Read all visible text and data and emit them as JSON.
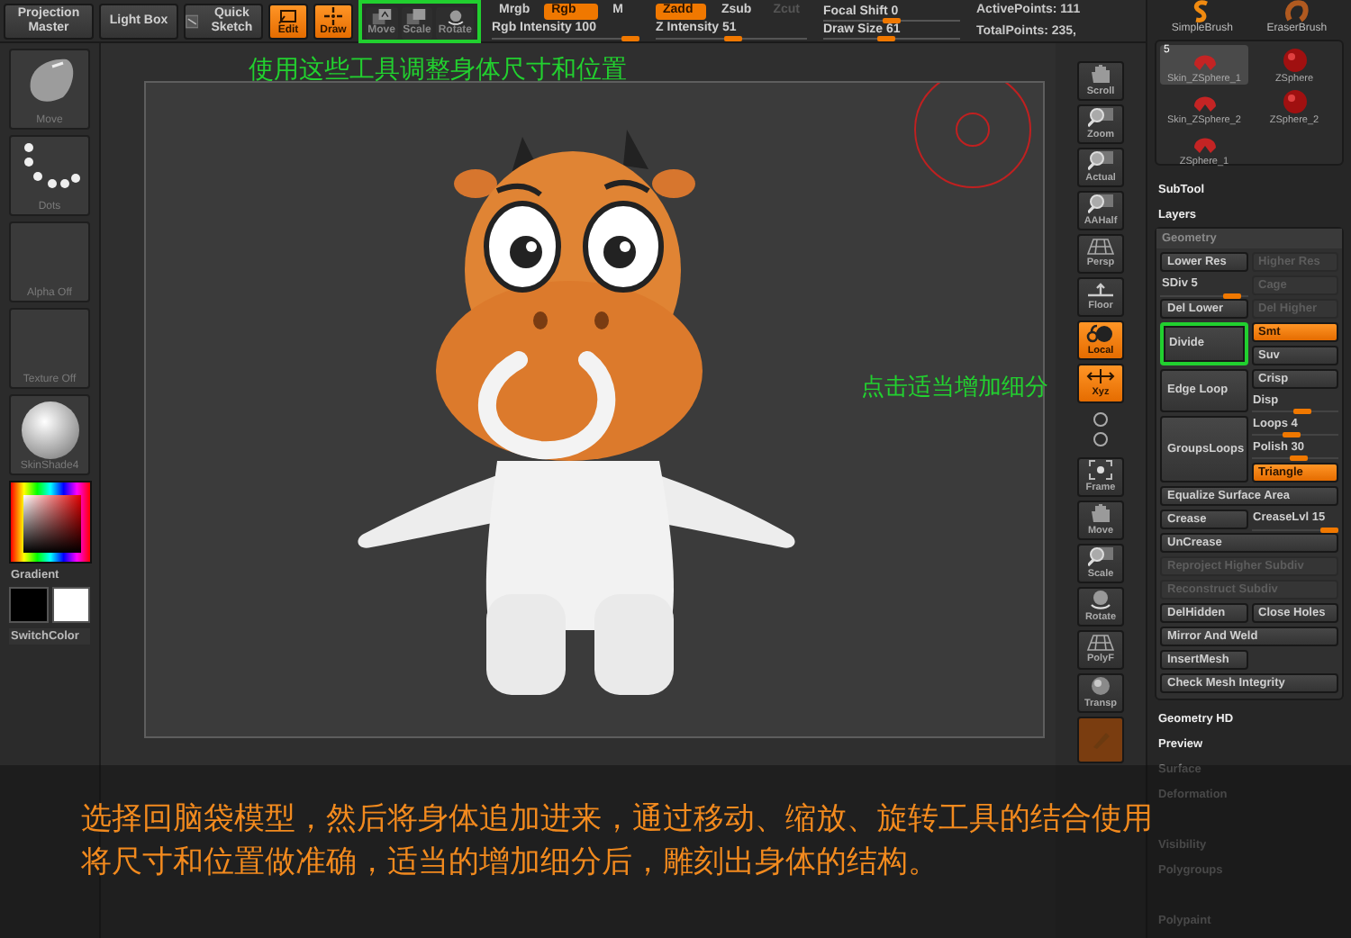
{
  "top_bar": {
    "buttons": [
      {
        "label": "Projection Master",
        "kind": "text",
        "on": false
      },
      {
        "label": "Light Box",
        "kind": "text",
        "on": false
      },
      {
        "label": "Quick Sketch",
        "kind": "sketch",
        "on": false
      },
      {
        "label": "Edit",
        "kind": "edit",
        "on": true
      },
      {
        "label": "Draw",
        "kind": "draw",
        "on": true
      }
    ],
    "transform_tools": {
      "highlighted": true,
      "buttons": [
        {
          "label": "Move",
          "kind": "move",
          "on": false
        },
        {
          "label": "Scale",
          "kind": "scale",
          "on": false
        },
        {
          "label": "Rotate",
          "kind": "rotate",
          "on": false
        }
      ]
    },
    "color_modes": [
      {
        "label": "Mrgb",
        "selected": false
      },
      {
        "label": "Rgb",
        "selected": true
      },
      {
        "label": "M",
        "selected": false
      }
    ],
    "rgb_intensity": {
      "label": "Rgb Intensity 100",
      "level": 1.0
    },
    "z_modes": [
      {
        "label": "Zadd",
        "selected": true,
        "disabled": false
      },
      {
        "label": "Zsub",
        "selected": false,
        "disabled": false
      },
      {
        "label": "Zcut",
        "selected": false,
        "disabled": true
      }
    ],
    "z_intensity": {
      "label": "Z Intensity 51",
      "level": 0.51
    },
    "focal_shift": {
      "label": "Focal Shift 0",
      "level": 0.5
    },
    "draw_size": {
      "label": "Draw Size 61",
      "level": 0.45
    },
    "active_points": "ActivePoints: 111",
    "total_points": "TotalPoints: 235,"
  },
  "left_panel": {
    "thumbnails": [
      {
        "label": "Move",
        "kind": "brush"
      },
      {
        "label": "Dots",
        "kind": "stroke"
      },
      {
        "label": "Alpha Off",
        "kind": "alpha"
      },
      {
        "label": "Texture Off",
        "kind": "texture"
      },
      {
        "label": "SkinShade4",
        "kind": "material"
      }
    ],
    "gradient_label": "Gradient",
    "switch_label": "SwitchColor"
  },
  "canvas": {
    "tools_note": "使用这些工具调整身体尺寸和位置",
    "divide_note": "点击适当增加细分"
  },
  "right_toolbar": [
    {
      "label": "Scroll",
      "kind": "hand",
      "on": false
    },
    {
      "label": "Zoom",
      "kind": "zoom",
      "on": false
    },
    {
      "label": "Actual",
      "kind": "zoom",
      "on": false
    },
    {
      "label": "AAHalf",
      "kind": "zoom",
      "on": false
    },
    {
      "label": "Persp",
      "kind": "grid",
      "on": false
    },
    {
      "label": "Floor",
      "kind": "floor",
      "on": false
    },
    {
      "label": "Local",
      "kind": "local",
      "on": true
    },
    {
      "label": "Xyz",
      "kind": "axes",
      "on": true
    },
    {
      "kind": "mini",
      "on": false
    },
    {
      "label": "Frame",
      "kind": "frame",
      "on": false
    },
    {
      "label": "Move",
      "kind": "hand",
      "on": false
    },
    {
      "label": "Scale",
      "kind": "zoom",
      "on": false
    },
    {
      "label": "Rotate",
      "kind": "rotate",
      "on": false
    },
    {
      "label": "PolyF",
      "kind": "grid",
      "on": false
    },
    {
      "label": "Transp",
      "kind": "sphere",
      "on": false
    },
    {
      "kind": "ghost",
      "on": true
    }
  ],
  "tool_palette": {
    "brushes": [
      {
        "label": "SimpleBrush",
        "kind": "simple"
      },
      {
        "label": "EraserBrush",
        "kind": "eraser"
      }
    ],
    "tools": [
      {
        "label": "Skin_ZSphere_1",
        "kind": "skin",
        "selected": true,
        "badge": "5"
      },
      {
        "label": "ZSphere",
        "kind": "sphere",
        "selected": false
      },
      {
        "label": "Skin_ZSphere_2",
        "kind": "skin",
        "selected": false
      },
      {
        "label": "ZSphere_2",
        "kind": "sphere",
        "selected": false
      },
      {
        "label": "ZSphere_1",
        "kind": "skin",
        "selected": false
      }
    ]
  },
  "subpalettes_top": [
    "SubTool",
    "Layers"
  ],
  "geometry": {
    "title": "Geometry",
    "rows": [
      {
        "items": [
          {
            "kind": "button",
            "label": "Lower Res",
            "disabled": false
          },
          {
            "kind": "button",
            "label": "Higher Res",
            "disabled": true
          }
        ]
      },
      {
        "items": [
          {
            "kind": "slider",
            "label": "SDiv 5",
            "level": 0.9
          },
          {
            "kind": "button",
            "label": "Cage",
            "disabled": true
          }
        ]
      },
      {
        "items": [
          {
            "kind": "button",
            "label": "Del Lower",
            "disabled": false
          },
          {
            "kind": "button",
            "label": "Del Higher",
            "disabled": true
          }
        ]
      },
      {
        "left": {
          "kind": "button",
          "label": "Divide",
          "disabled": false,
          "highlighted": true
        },
        "right": [
          {
            "kind": "toggle",
            "label": "Smt",
            "on": true
          },
          {
            "kind": "toggle",
            "label": "Suv",
            "on": false
          }
        ]
      },
      {
        "left": {
          "kind": "button",
          "label": "Edge Loop",
          "disabled": false,
          "highlighted": false
        },
        "right": [
          {
            "kind": "toggle",
            "label": "Crisp",
            "on": false
          },
          {
            "kind": "slider",
            "label": "Disp",
            "level": 0.6
          }
        ]
      },
      {
        "left": {
          "kind": "button",
          "label": "GroupsLoops",
          "disabled": false,
          "highlighted": false
        },
        "right": [
          {
            "kind": "slider",
            "label": "Loops 4",
            "level": 0.45
          },
          {
            "kind": "slider",
            "label": "Polish 30",
            "level": 0.55
          },
          {
            "kind": "toggle",
            "label": "Triangle",
            "on": true
          }
        ]
      },
      {
        "items": [
          {
            "kind": "wide",
            "label": "Equalize Surface Area",
            "disabled": false
          }
        ]
      },
      {
        "items": [
          {
            "kind": "button",
            "label": "Crease",
            "disabled": false
          },
          {
            "kind": "slider",
            "label": "CreaseLvl 15",
            "level": 1.0
          }
        ]
      },
      {
        "items": [
          {
            "kind": "wide",
            "label": "UnCrease",
            "disabled": false
          }
        ]
      },
      {
        "items": [
          {
            "kind": "wide",
            "label": "Reproject Higher Subdiv",
            "disabled": true
          }
        ]
      },
      {
        "items": [
          {
            "kind": "wide",
            "label": "Reconstruct Subdiv",
            "disabled": true
          }
        ]
      },
      {
        "items": [
          {
            "kind": "button",
            "label": "DelHidden",
            "disabled": false
          },
          {
            "kind": "button",
            "label": "Close Holes",
            "disabled": false
          }
        ]
      },
      {
        "items": [
          {
            "kind": "wide",
            "label": "Mirror And Weld",
            "disabled": false
          }
        ]
      },
      {
        "items": [
          {
            "kind": "button",
            "label": "InsertMesh",
            "disabled": false
          }
        ]
      },
      {
        "items": [
          {
            "kind": "wide",
            "label": "Check Mesh Integrity",
            "disabled": false
          }
        ]
      }
    ]
  },
  "subpalettes_bottom": [
    {
      "label": "Geometry HD",
      "dimmed": false
    },
    {
      "label": "Preview",
      "dimmed": false
    },
    {
      "label": "Surface",
      "dimmed": true
    },
    {
      "label": "Deformation",
      "dimmed": true
    },
    {
      "label": "Visibility",
      "dimmed": true
    },
    {
      "label": "Polygroups",
      "dimmed": true
    },
    {
      "label": "Polypaint",
      "dimmed": true
    }
  ],
  "caption": {
    "lines": [
      "选择回脑袋模型，然后将身体追加进来，通过移动、缩放、旋转工具的结合使用",
      "将尺寸和位置做准确，适当的增加细分后，雕刻出身体的结构。"
    ]
  }
}
